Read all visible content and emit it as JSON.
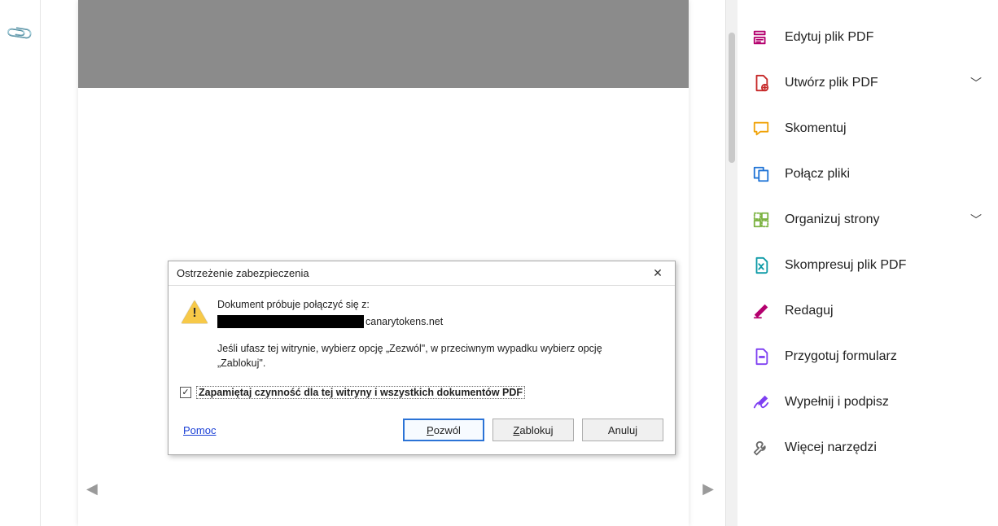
{
  "dialog": {
    "title": "Ostrzeżenie zabezpieczenia",
    "message_intro": "Dokument próbuje połączyć się z:",
    "url_visible_suffix": "canarytokens.net",
    "message_body": "Jeśli ufasz tej witrynie, wybierz opcję „Zezwól\", w przeciwnym wypadku wybierz opcję „Zablokuj\".",
    "remember_label": "Zapamiętaj czynność dla tej witryny i wszystkich dokumentów PDF",
    "remember_checked": true,
    "help_label": "Pomoc",
    "btn_allow": "Pozwól",
    "btn_block": "Zablokuj",
    "btn_cancel": "Anuluj",
    "close_glyph": "✕",
    "check_glyph": "✓"
  },
  "sidebar": {
    "items": [
      {
        "label": "Edytuj plik PDF",
        "icon": "edit-pdf-icon",
        "color": "#b4006e",
        "expandable": false
      },
      {
        "label": "Utwórz plik PDF",
        "icon": "create-pdf-icon",
        "color": "#c62828",
        "expandable": true
      },
      {
        "label": "Skomentuj",
        "icon": "comment-icon",
        "color": "#f0a30a",
        "expandable": false
      },
      {
        "label": "Połącz pliki",
        "icon": "combine-files-icon",
        "color": "#1f73d6",
        "expandable": false
      },
      {
        "label": "Organizuj strony",
        "icon": "organize-pages-icon",
        "color": "#7cb342",
        "expandable": true
      },
      {
        "label": "Skompresuj plik PDF",
        "icon": "compress-pdf-icon",
        "color": "#0c9aa6",
        "expandable": false
      },
      {
        "label": "Redaguj",
        "icon": "redact-icon",
        "color": "#b4006e",
        "expandable": false
      },
      {
        "label": "Przygotuj formularz",
        "icon": "prepare-form-icon",
        "color": "#7e3ff2",
        "expandable": false
      },
      {
        "label": "Wypełnij i podpisz",
        "icon": "fill-sign-icon",
        "color": "#7e3ff2",
        "expandable": false
      },
      {
        "label": "Więcej narzędzi",
        "icon": "more-tools-icon",
        "color": "#6b6b6b",
        "expandable": false
      }
    ],
    "chevron_glyph": "﹀"
  },
  "nav": {
    "left_glyph": "◀",
    "right_glyph": "▶"
  }
}
